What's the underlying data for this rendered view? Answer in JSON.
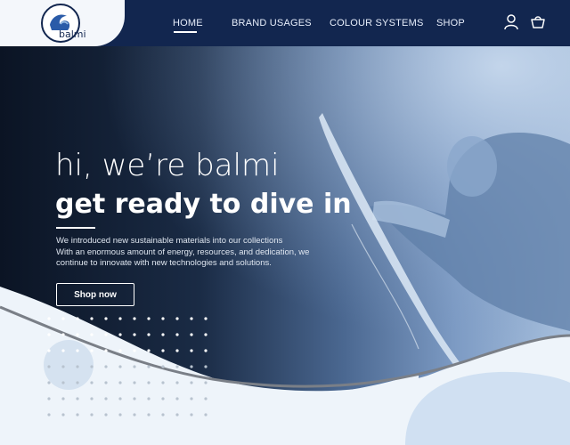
{
  "brand": {
    "name": "balmi",
    "logo_icon": "wave-logo-icon"
  },
  "nav": {
    "items": [
      {
        "label": "HOME",
        "active": true
      },
      {
        "label": "BRAND USAGES",
        "active": false
      },
      {
        "label": "COLOUR SYSTEMS",
        "active": false
      },
      {
        "label": "SHOP",
        "active": false
      }
    ],
    "icons": [
      "user-icon",
      "cart-icon"
    ]
  },
  "hero": {
    "heading_light": "hi, we’re balmi",
    "heading_bold": "get ready to dive in",
    "body_lines": [
      "We introduced new sustainable materials into our collections",
      "With an enormous amount of energy, resources, and dedication, we",
      "continue to innovate with new technologies and solutions."
    ],
    "cta_label": "Shop now"
  },
  "colors": {
    "header_bg": "#12264f",
    "accent_light": "#eef4fa",
    "dot_white": "#ffffff",
    "dot_grey": "#b8c3cf"
  }
}
